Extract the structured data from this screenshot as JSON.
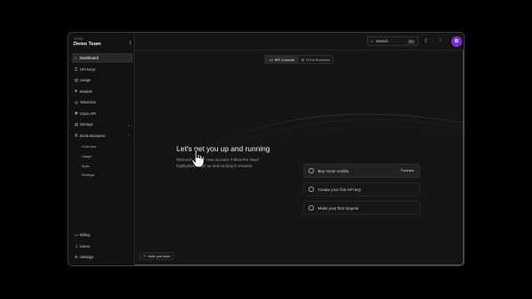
{
  "team": {
    "label": "TEAM",
    "name": "Demo Team",
    "caret": "⇕"
  },
  "nav": {
    "items": [
      {
        "label": "Dashboard",
        "icon": "⌂",
        "icon_name": "home-icon"
      },
      {
        "label": "API Keys",
        "icon": "⚿",
        "icon_name": "key-icon"
      },
      {
        "label": "Usage",
        "icon": "▥",
        "icon_name": "chart-icon"
      },
      {
        "label": "Models",
        "icon": "◈",
        "icon_name": "cube-icon"
      },
      {
        "label": "Tokenizer",
        "icon": "◎",
        "icon_name": "tokenizer-icon"
      },
      {
        "label": "Voice API",
        "icon": "◉",
        "icon_name": "voice-icon"
      },
      {
        "label": "Storage",
        "icon": "▤",
        "icon_name": "storage-icon"
      },
      {
        "label": "Drink Business",
        "icon": "◍",
        "icon_name": "drink-icon"
      }
    ],
    "storage_caret": "⌄",
    "business_caret": "⌃",
    "subitems": [
      "Overview",
      "Usage",
      "Apps",
      "Settings"
    ],
    "bottom": [
      {
        "label": "Billing",
        "icon": "▭",
        "icon_name": "billing-icon"
      },
      {
        "label": "Users",
        "icon": "☺",
        "icon_name": "users-icon"
      },
      {
        "label": "Settings",
        "icon": "⚙",
        "icon_name": "gear-icon"
      }
    ]
  },
  "topbar": {
    "search_label": "Search",
    "search_icon": "⌕",
    "shortcut": "⌘K",
    "book_icon": "▯",
    "theme_icon": "☾",
    "avatar_initial": "B"
  },
  "switcher": {
    "options": [
      {
        "label": "API Console",
        "icon": "▭"
      },
      {
        "label": "Drink Business",
        "icon": "◍"
      }
    ]
  },
  "hero": {
    "title": "Let's get you up and running",
    "subtitle": "Welcome to your new account. Follow the steps highlighted to get up and running in minutes."
  },
  "steps": [
    {
      "label": "Buy some credits",
      "action": "Purchase"
    },
    {
      "label": "Create your first API key",
      "action": ""
    },
    {
      "label": "Make your first request",
      "action": ""
    }
  ],
  "invite": {
    "label": "Invite your team",
    "icon": "⚇"
  },
  "colors": {
    "accent_avatar": "#7b2fd3",
    "window_bg": "#151515",
    "sidebar_bg": "#121212"
  }
}
